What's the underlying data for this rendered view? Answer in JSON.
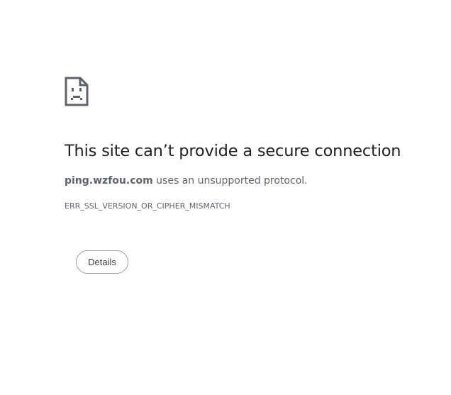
{
  "icon": "sad-page-icon",
  "title": "This site can’t provide a secure connection",
  "description": {
    "host": "ping.wzfou.com",
    "message": " uses an unsupported protocol."
  },
  "error_code": "ERR_SSL_VERSION_OR_CIPHER_MISMATCH",
  "details_button_label": "Details",
  "colors": {
    "title": "#202124",
    "body_text": "#5f6368",
    "icon": "#5f6368",
    "button_border": "#9aa0a6"
  }
}
